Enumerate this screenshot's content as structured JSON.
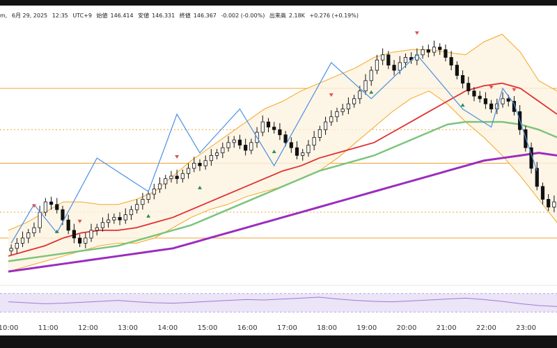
{
  "header": {
    "symbol_fragment": "m,",
    "date": "6月 29, 2025",
    "time": "12:35",
    "timezone": "UTC+9",
    "open_label": "始値",
    "open_value": "146.414",
    "close_label": "安値",
    "close_value": "146.331",
    "final_label": "終値",
    "final_value": "146.367",
    "change_value": "-0.002 (-0.00%)",
    "volume_label": "出来高",
    "volume_value": "2.18K",
    "change2_value": "+0.276 (+0.19%)"
  },
  "colors": {
    "up_candle": "#ffffff",
    "down_candle": "#111111",
    "bollinger": "#f5a623",
    "bollinger_fill": "#fdf3e0",
    "ema_red": "#e03030",
    "sma_green": "#7cc47c",
    "sma_purple": "#9b2dbd",
    "zigzag": "#4a90e2",
    "horizontal_level": "#f0a030",
    "marker_up": "#2e8b57",
    "marker_down": "#e05050",
    "rsi_line": "#9c7bd6",
    "rsi_band": "#ece4f7"
  },
  "chart_data": {
    "type": "candlestick",
    "x_tick_labels": [
      "10:00",
      "11:00",
      "12:00",
      "13:00",
      "14:00",
      "15:00",
      "16:00",
      "17:00",
      "18:00",
      "19:00",
      "20:00",
      "21:00",
      "22:00",
      "23:00"
    ],
    "ohlc_index_note": "x index: 0 = 10:00, 12 candles per hour",
    "closes": [
      146.58,
      146.62,
      146.66,
      146.7,
      146.74,
      146.86,
      146.94,
      146.92,
      146.88,
      146.8,
      146.72,
      146.66,
      146.62,
      146.66,
      146.72,
      146.74,
      146.78,
      146.8,
      146.82,
      146.8,
      146.84,
      146.88,
      146.92,
      146.96,
      147.0,
      147.04,
      147.08,
      147.12,
      147.14,
      147.12,
      147.16,
      147.2,
      147.24,
      147.22,
      147.26,
      147.3,
      147.32,
      147.36,
      147.4,
      147.42,
      147.38,
      147.34,
      147.4,
      147.48,
      147.56,
      147.52,
      147.5,
      147.46,
      147.4,
      147.36,
      147.3,
      147.32,
      147.38,
      147.44,
      147.5,
      147.56,
      147.6,
      147.64,
      147.66,
      147.7,
      147.74,
      147.8,
      147.88,
      147.96,
      148.04,
      148.08,
      148.0,
      147.96,
      148.02,
      148.06,
      148.04,
      148.08,
      148.12,
      148.1,
      148.14,
      148.12,
      148.06,
      148.0,
      147.92,
      147.86,
      147.8,
      147.76,
      147.74,
      147.7,
      147.66,
      147.7,
      147.74,
      147.72,
      147.64,
      147.5,
      147.36,
      147.2,
      147.06,
      146.96,
      146.9,
      146.94
    ],
    "zigzag": [
      [
        0,
        146.62
      ],
      [
        4,
        146.92
      ],
      [
        8,
        146.7
      ],
      [
        15,
        147.28
      ],
      [
        24,
        147.02
      ],
      [
        29,
        147.62
      ],
      [
        33,
        147.32
      ],
      [
        40,
        147.66
      ],
      [
        46,
        147.22
      ],
      [
        56,
        148.02
      ],
      [
        63,
        147.74
      ],
      [
        71,
        148.08
      ],
      [
        79,
        147.66
      ],
      [
        84,
        147.52
      ],
      [
        86,
        147.82
      ],
      [
        88,
        147.7
      ],
      [
        92,
        147.18
      ]
    ],
    "markers_down_at": [
      4,
      12,
      29,
      56,
      71,
      84,
      88
    ],
    "markers_up_at": [
      8,
      24,
      33,
      46,
      63,
      79
    ],
    "horizontal_levels": [
      147.82,
      147.5,
      147.24,
      146.86,
      146.66
    ],
    "ema_red": [
      146.52,
      146.56,
      146.6,
      146.66,
      146.7,
      146.72,
      146.72,
      146.74,
      146.78,
      146.82,
      146.88,
      146.94,
      147.0,
      147.06,
      147.12,
      147.18,
      147.22,
      147.28,
      147.32,
      147.36,
      147.4,
      147.48,
      147.56,
      147.64,
      147.72,
      147.8,
      147.84,
      147.86,
      147.82,
      147.72,
      147.62
    ],
    "sma_green": [
      146.48,
      146.5,
      146.52,
      146.54,
      146.56,
      146.58,
      146.6,
      146.64,
      146.68,
      146.72,
      146.76,
      146.82,
      146.88,
      146.94,
      147.0,
      147.06,
      147.12,
      147.18,
      147.22,
      147.26,
      147.3,
      147.36,
      147.42,
      147.48,
      147.54,
      147.56,
      147.56,
      147.56,
      147.54,
      147.5,
      147.44
    ],
    "sma_purple": [
      146.4,
      146.42,
      146.44,
      146.46,
      146.48,
      146.5,
      146.52,
      146.54,
      146.56,
      146.58,
      146.62,
      146.66,
      146.7,
      146.74,
      146.78,
      146.82,
      146.86,
      146.9,
      146.94,
      146.98,
      147.02,
      147.06,
      147.1,
      147.14,
      147.18,
      147.22,
      147.26,
      147.28,
      147.3,
      147.32,
      147.3
    ],
    "bb_upper": [
      146.72,
      146.78,
      146.86,
      146.94,
      146.94,
      146.92,
      146.92,
      146.96,
      147.02,
      147.14,
      147.26,
      147.36,
      147.46,
      147.56,
      147.66,
      147.72,
      147.8,
      147.86,
      147.92,
      147.98,
      148.06,
      148.1,
      148.12,
      148.12,
      148.1,
      148.08,
      148.18,
      148.24,
      148.1,
      147.88,
      147.8
    ],
    "bb_lower": [
      146.4,
      146.44,
      146.48,
      146.52,
      146.56,
      146.6,
      146.62,
      146.62,
      146.66,
      146.74,
      146.82,
      146.88,
      146.92,
      146.98,
      147.02,
      147.06,
      147.12,
      147.18,
      147.28,
      147.4,
      147.52,
      147.64,
      147.74,
      147.8,
      147.7,
      147.56,
      147.44,
      147.3,
      147.14,
      146.96,
      146.78
    ],
    "ylim": [
      146.32,
      148.3
    ],
    "rsi": [
      52,
      50,
      48,
      49,
      51,
      53,
      55,
      52,
      50,
      49,
      51,
      53,
      55,
      57,
      56,
      58,
      60,
      62,
      58,
      55,
      53,
      52,
      54,
      56,
      58,
      60,
      57,
      53,
      48,
      44,
      42
    ],
    "rsi_ylim": [
      20,
      80
    ]
  }
}
